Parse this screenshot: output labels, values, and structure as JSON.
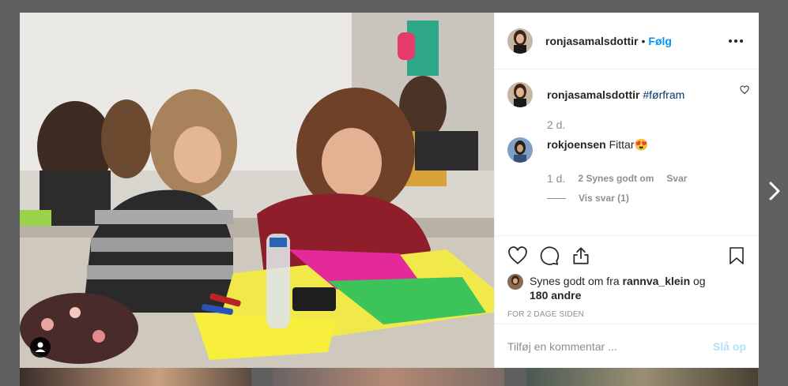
{
  "post": {
    "author": "ronjasamalsdottir",
    "follow_label": "Følg",
    "separator": "•",
    "caption": {
      "username": "ronjasamalsdottir",
      "hashtag": "#førfram",
      "age": "2 d."
    },
    "comments": [
      {
        "username": "rokjoensen",
        "text": "Fittar😍",
        "age": "1 d.",
        "likes": "2 Synes godt om",
        "reply_label": "Svar",
        "view_replies": "Vis svar (1)"
      }
    ],
    "liked_by": {
      "prefix": "Synes godt om fra",
      "user": "rannva_klein",
      "joiner": "og",
      "others": "180 andre"
    },
    "timestamp": "FOR 2 DAGE SIDEN",
    "add_comment_placeholder": "Tilføj en kommentar ...",
    "post_button": "Slå op"
  },
  "icons": {
    "more": "more-options-icon",
    "like": "heart-icon",
    "comment": "comment-icon",
    "share": "share-icon",
    "save": "bookmark-icon",
    "tag": "user-tag-icon",
    "next": "chevron-right-icon"
  },
  "colors": {
    "accent": "#0095f6",
    "hashtag": "#00376b",
    "muted": "#8e8e8e",
    "backdrop": "#5f5f5f"
  }
}
